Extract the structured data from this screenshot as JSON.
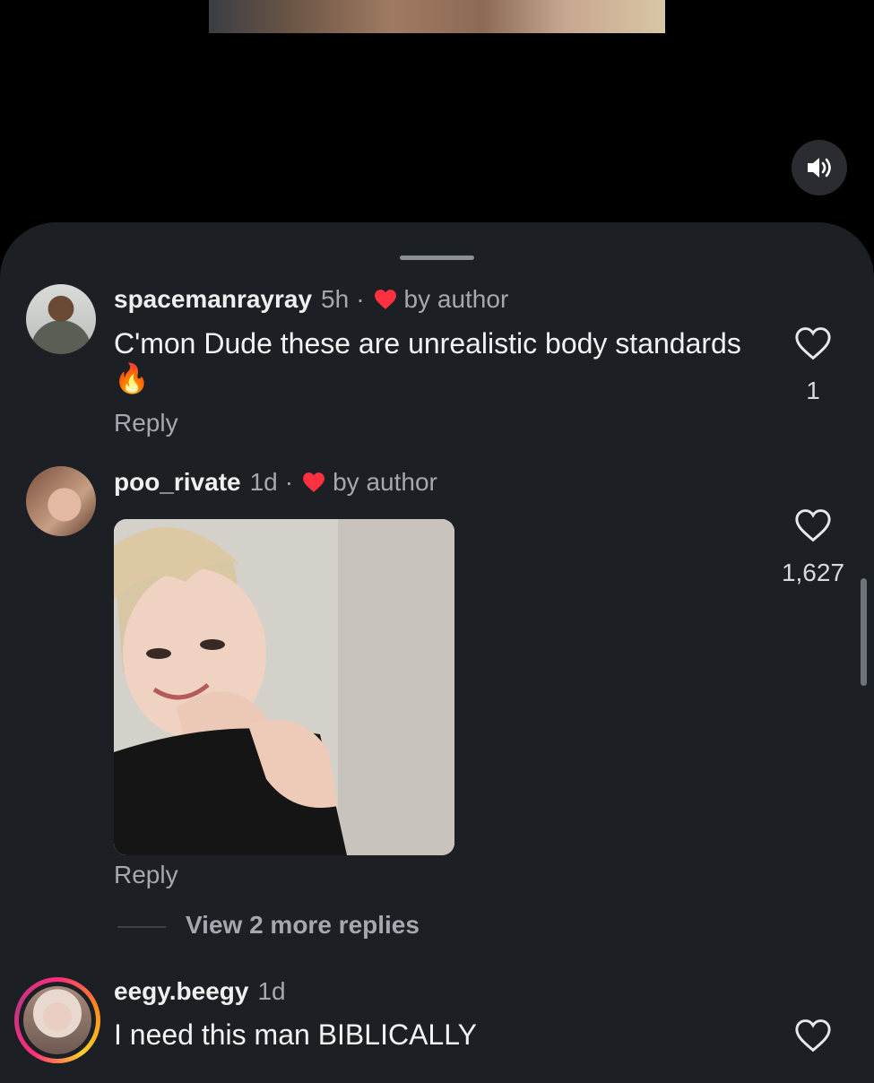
{
  "comments": [
    {
      "username": "spacemanrayray",
      "time": "5h",
      "separator": "·",
      "author_like_label": "by author",
      "text": "C'mon Dude these are unrealistic body standards",
      "emoji": "🔥",
      "reply_label": "Reply",
      "like_count": "1"
    },
    {
      "username": "poo_rivate",
      "time": "1d",
      "separator": "·",
      "author_like_label": "by author",
      "reply_label": "Reply",
      "like_count": "1,627",
      "view_more_label": "View 2 more replies"
    },
    {
      "username": "eegy.beegy",
      "time": "1d",
      "text": "I need this man BIBLICALLY"
    }
  ],
  "colors": {
    "sheet_bg": "#1c1f23",
    "author_heart": "#ff3040",
    "muted_text": "#a5a9af"
  },
  "icons": [
    "sound-on-icon",
    "heart-outline-icon",
    "heart-filled-icon",
    "fire-emoji"
  ]
}
